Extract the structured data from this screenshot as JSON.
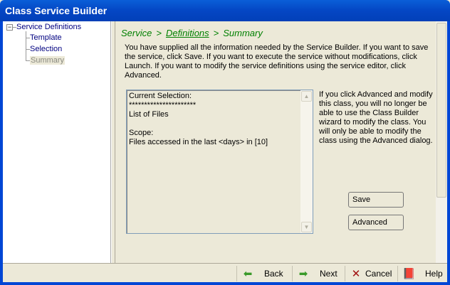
{
  "window": {
    "title": "Class Service Builder"
  },
  "tree": {
    "root": "Service Definitions",
    "expander": "−",
    "children": [
      {
        "label": "Template"
      },
      {
        "label": "Selection"
      },
      {
        "label": "Summary"
      }
    ]
  },
  "breadcrumb": {
    "items": [
      "Service",
      ">",
      "Definitions",
      ">",
      "Summary"
    ]
  },
  "intro": "You have supplied all the information needed by the Service Builder. If you want to save the service, click Save. If you want to execute the service without modifications, click Launch. If you want to modify the service definitions using the service editor, click Advanced.",
  "selection_text": "Current Selection:\n**********************\nList of Files\n\nScope:\nFiles accessed in the last <days> in [10]",
  "note": "If you click Advanced and modify this class, you will no longer be able to use the Class Builder wizard to modify the class. You will only be able to modify the class using the Advanced dialog.",
  "buttons": {
    "save": "Save",
    "advanced": "Advanced"
  },
  "nav": {
    "back": "Back",
    "next": "Next",
    "cancel": "Cancel",
    "help": "Help"
  },
  "scroll": {
    "up": "▲",
    "down": "▼"
  }
}
